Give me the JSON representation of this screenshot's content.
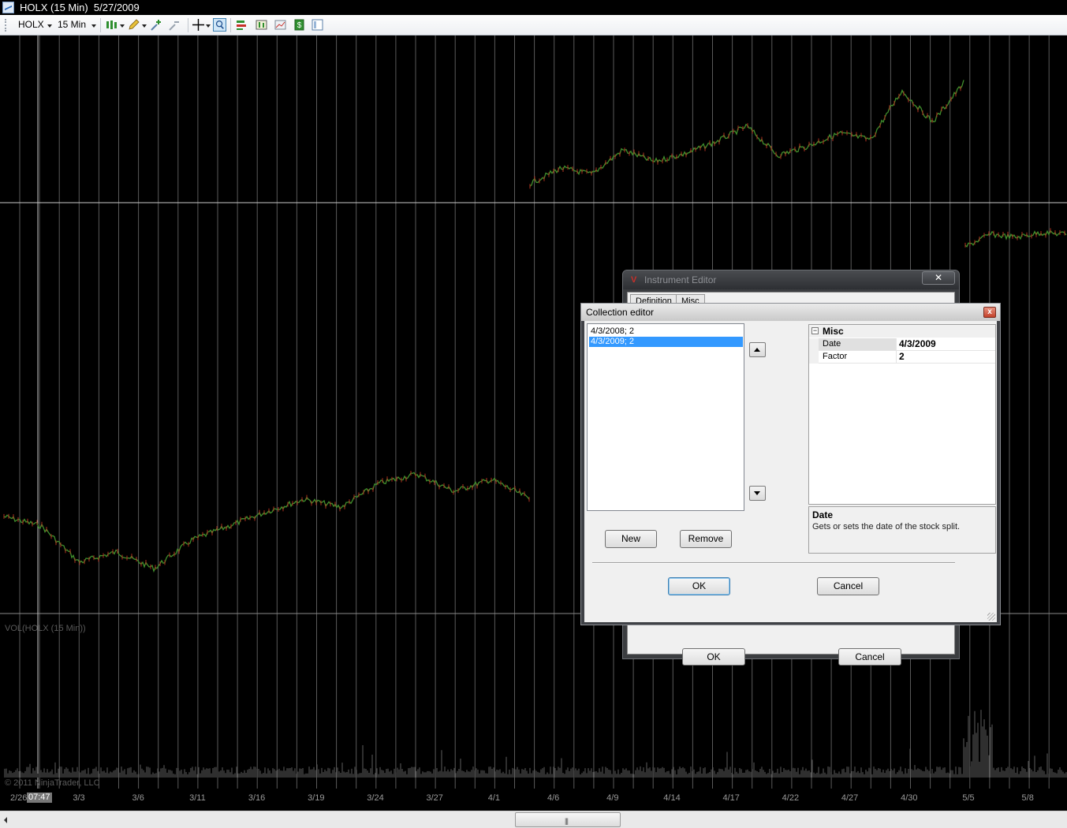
{
  "window": {
    "title": "HOLX (15 Min)  5/27/2009"
  },
  "toolbar": {
    "instrument": "HOLX",
    "interval": "15 Min",
    "icons": [
      "bar-type-icon",
      "drawing-pencil-icon",
      "add-indicator-icon",
      "remove-indicator-icon",
      "crosshair-icon",
      "data-box-icon",
      "properties-icon",
      "strategy-icon",
      "chart-trader-icon",
      "dollar-icon",
      "template-icon"
    ]
  },
  "chart": {
    "price_series_color": "#3f8f2c",
    "down_color": "#b03020",
    "grid_color": "#5a5a5a",
    "volume_label": "VOL(HOLX (15 Min))",
    "copyright": "© 2011 NinjaTrader, LLC",
    "cursor_time": "07:47",
    "first_date": "2/26",
    "x_labels": [
      "3/3",
      "3/6",
      "3/11",
      "3/16",
      "3/19",
      "3/24",
      "3/27",
      "4/1",
      "4/6",
      "4/9",
      "4/14",
      "4/17",
      "4/22",
      "4/27",
      "4/30",
      "5/5",
      "5/8"
    ]
  },
  "instrument_editor": {
    "title": "Instrument Editor",
    "tabs": [
      "Definition",
      "Misc"
    ],
    "ok_label": "OK",
    "cancel_label": "Cancel"
  },
  "collection_editor": {
    "title": "Collection editor",
    "close_label": "x",
    "items": [
      {
        "label": "4/3/2008; 2",
        "selected": false
      },
      {
        "label": "4/3/2009; 2",
        "selected": true
      }
    ],
    "properties": {
      "category": "Misc",
      "rows": [
        {
          "name": "Date",
          "value": "4/3/2009"
        },
        {
          "name": "Factor",
          "value": "2"
        }
      ]
    },
    "help": {
      "title": "Date",
      "text": "Gets or sets the date of the stock split."
    },
    "new_label": "New",
    "remove_label": "Remove",
    "ok_label": "OK",
    "cancel_label": "Cancel"
  }
}
